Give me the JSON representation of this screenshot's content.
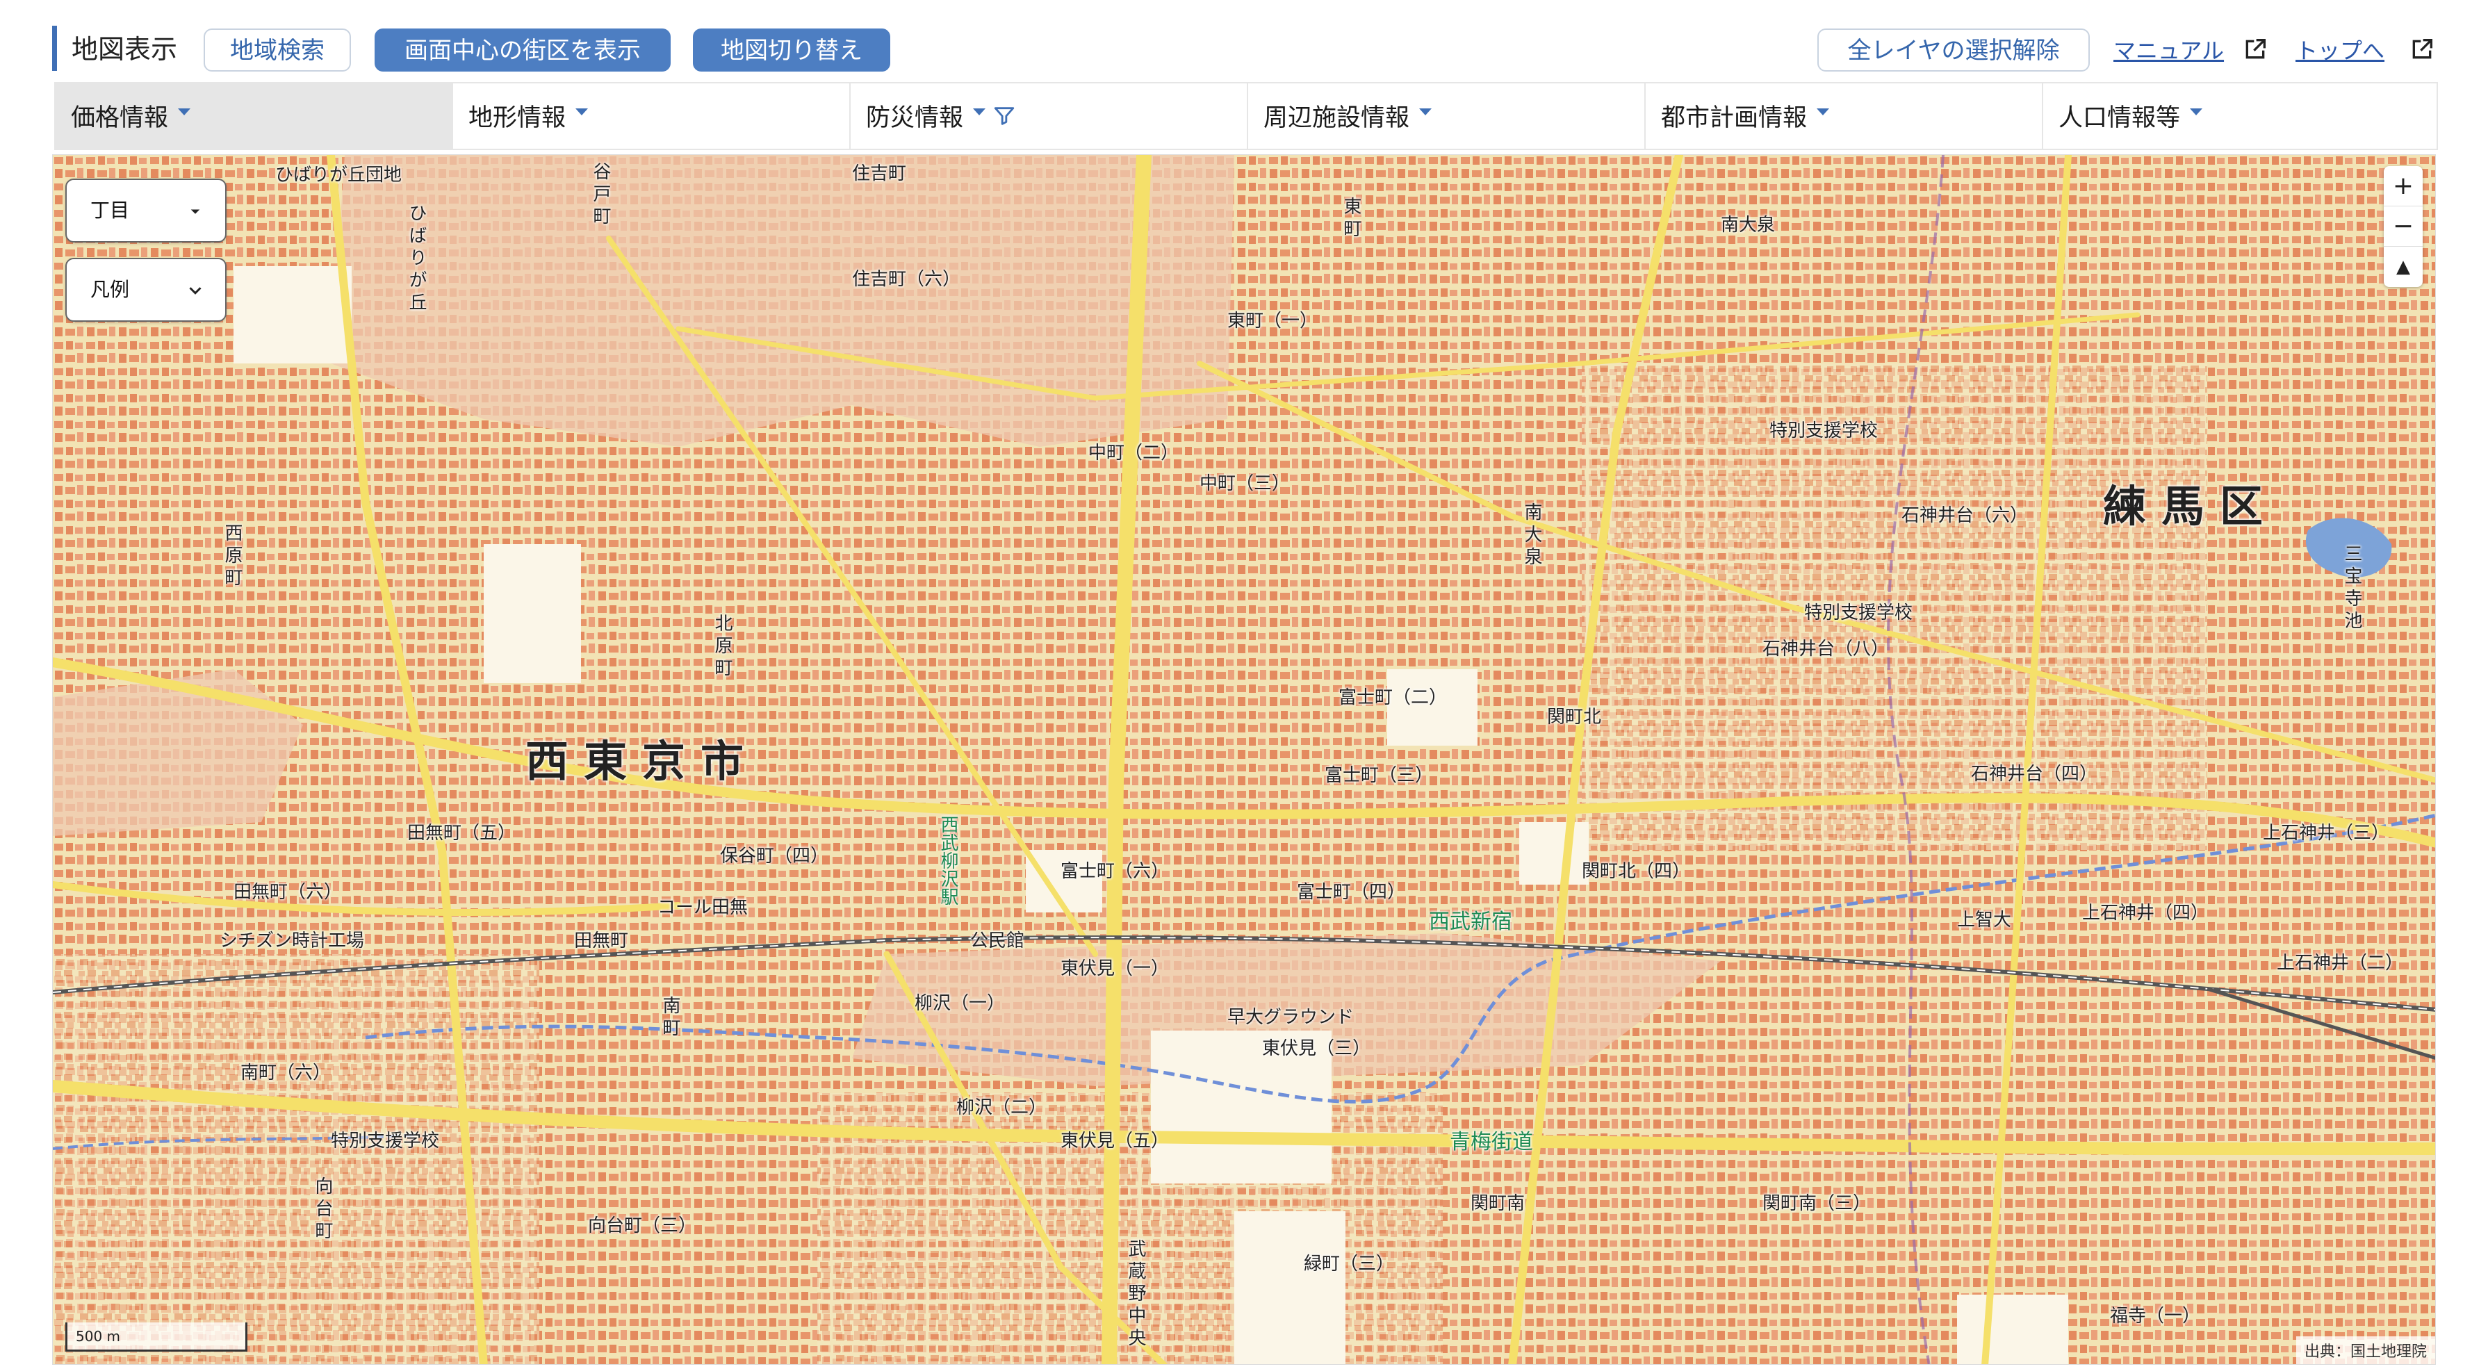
{
  "toolbar": {
    "title": "地図表示",
    "region_search": "地域検索",
    "show_center_block": "画面中心の街区を表示",
    "switch_map": "地図切り替え",
    "clear_layers": "全レイヤの選択解除",
    "manual": "マニュアル",
    "top": "トップへ"
  },
  "tabs": [
    {
      "label": "価格情報",
      "active": true
    },
    {
      "label": "地形情報"
    },
    {
      "label": "防災情報",
      "has_filter": true
    },
    {
      "label": "周辺施設情報"
    },
    {
      "label": "都市計画情報"
    },
    {
      "label": "人口情報等"
    }
  ],
  "map": {
    "level_select": "丁目",
    "legend_select": "凡例",
    "zoom_in": "+",
    "zoom_out": "−",
    "reset_north": "▲",
    "scale": "500 m",
    "attribution": "出典：国土地理院",
    "colors": {
      "background": "#f2e3b4",
      "building": "#e8956a",
      "road": "#f5e06a",
      "water": "#7da3d8",
      "pale_pink": "#efc9b0"
    },
    "labels": {
      "city_west": "西東京市",
      "ward_nerima": "練馬区",
      "hibarigaoka": "ひばりが丘団地",
      "hibarigaoka_sub": "ひばりが丘",
      "sumiyoshi": "住吉町",
      "sumiyoshi_6": "住吉町（六）",
      "higashimachi": "東町",
      "higashimachi_1": "東町（一）",
      "nakamachi": "中町（二）",
      "nakamachi_3": "中町（三）",
      "minamioizumi": "南大泉",
      "tokubetsu1": "特別支援学校",
      "tokubetsu2": "特別支援学校",
      "tokubetsu3": "特別支援学校",
      "shakujii": "石神井台（六）",
      "shakujii8": "石神井台（八）",
      "shakujii4": "石神井台（四）",
      "shakujii_ri": "石神井",
      "sanpoji": "三宝寺池",
      "fujimachi": "富士町（二）",
      "fujimachi3": "富士町（三）",
      "fujimachi6": "富士町（六）",
      "fujimachi4": "富士町（四）",
      "sekimachi": "関町北",
      "sekimachi4": "関町北（四）",
      "sekimachi_minami": "関町南",
      "sekimachi_minami3": "関町南（三）",
      "hoya": "保谷町（四）",
      "tanashi": "田無町",
      "tanashi5": "田無町（五）",
      "tanashi6": "田無町（六）",
      "citizen": "シチズン時計工場",
      "coal": "コール田無",
      "minamicho": "南町（六）",
      "minamicho_a": "南町",
      "higashifushimi": "東伏見（一）",
      "higashifushimi5": "東伏見（五）",
      "higashifushimi3": "東伏見（三）",
      "yanagisawa": "柳沢（一）",
      "yanagisawa2": "柳沢（二）",
      "seibu_shinjuku": "西武新宿",
      "seibu_line": "西武柳沢駅",
      "oume": "青梅街道",
      "midoricho": "緑町（三）",
      "kamishakujii": "上石神井（三）",
      "kamishakujii4": "上石神井（四）",
      "kamishakujii2": "上石神井（二）",
      "kamichi": "上智大",
      "kouminkan": "公民館",
      "musashino": "武蔵野中央",
      "waseda": "早大グラウンド",
      "nishihara": "西原町",
      "koyamachi": "谷戸町",
      "kitahara": "北原町",
      "fukushi": "福寺（一）",
      "mukodai": "向台町（三）",
      "aza": "向台町"
    }
  }
}
